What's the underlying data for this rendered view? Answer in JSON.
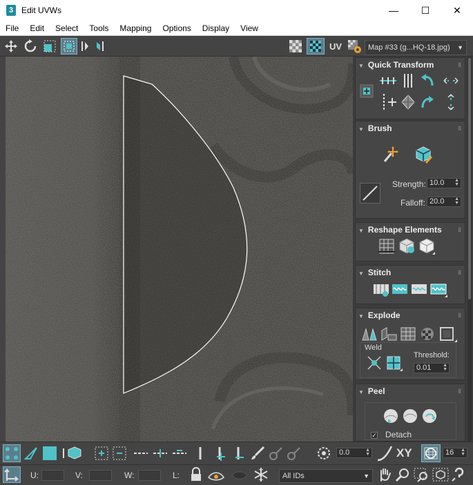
{
  "window": {
    "title": "Edit UVWs",
    "app_icon_glyph": "3",
    "controls": {
      "minimize": "—",
      "maximize": "☐",
      "close": "✕"
    }
  },
  "menu": [
    "File",
    "Edit",
    "Select",
    "Tools",
    "Mapping",
    "Options",
    "Display",
    "View"
  ],
  "toolbar": {
    "uv_label": "UV",
    "map_select": "Map #33 (g...HQ-18.jpg)"
  },
  "panel": {
    "quick_transform": {
      "title": "Quick Transform"
    },
    "brush": {
      "title": "Brush",
      "strength_label": "Strength:",
      "strength_value": "10.0",
      "falloff_label": "Falloff:",
      "falloff_value": "20.0"
    },
    "reshape": {
      "title": "Reshape Elements"
    },
    "stitch": {
      "title": "Stitch"
    },
    "explode": {
      "title": "Explode",
      "weld_label": "Weld",
      "threshold_label": "Threshold:",
      "threshold_value": "0.01"
    },
    "peel": {
      "title": "Peel",
      "detach_label": "Detach",
      "detach_checked": true
    }
  },
  "bottom": {
    "rotation_value": "0.0",
    "xy_label": "XY",
    "grid_value": "16",
    "u_label": "U:",
    "v_label": "V:",
    "w_label": "W:",
    "l_label": "L:",
    "id_filter": "All IDs"
  },
  "colors": {
    "accent": "#4fc3c9",
    "panel_bg": "#464646",
    "ui_bg": "#444444"
  }
}
